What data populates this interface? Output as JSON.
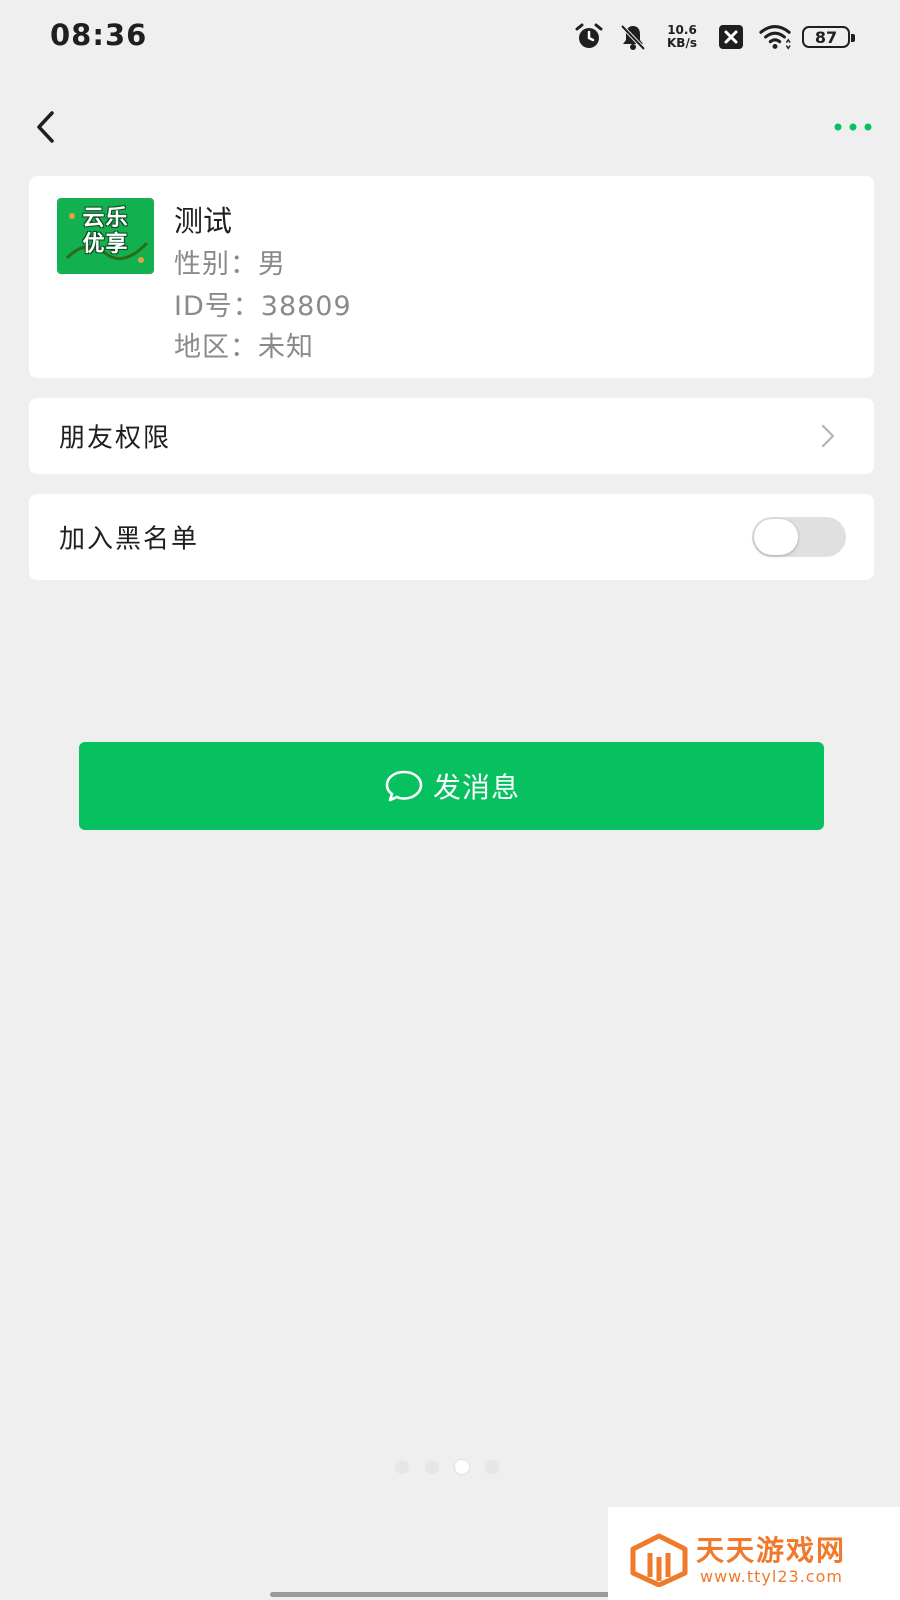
{
  "status_bar": {
    "time": "08:36",
    "net_speed_value": "10.6",
    "net_speed_unit": "KB/s",
    "battery": "87",
    "icons": [
      "alarm-icon",
      "mute-bell-icon",
      "close-box-icon",
      "wifi-icon",
      "battery-icon"
    ]
  },
  "nav": {
    "back_icon": "chevron-left-icon",
    "more_icon": "more-dots-icon",
    "accent_color": "#07c160"
  },
  "profile": {
    "avatar_text_line1": "云乐",
    "avatar_text_line2": "优享",
    "name": "测试",
    "gender_label": "性别：",
    "gender_value": "男",
    "id_label": "ID号：",
    "id_value": "38809",
    "region_label": "地区：",
    "region_value": "未知"
  },
  "settings": {
    "friend_permission_label": "朋友权限",
    "blacklist_label": "加入黑名单",
    "blacklist_enabled": false
  },
  "actions": {
    "send_message_label": "发消息"
  },
  "pager": {
    "count": 4,
    "active_index": 2
  },
  "watermark": {
    "title": "天天游戏网",
    "url": "www.ttyl23.com"
  }
}
